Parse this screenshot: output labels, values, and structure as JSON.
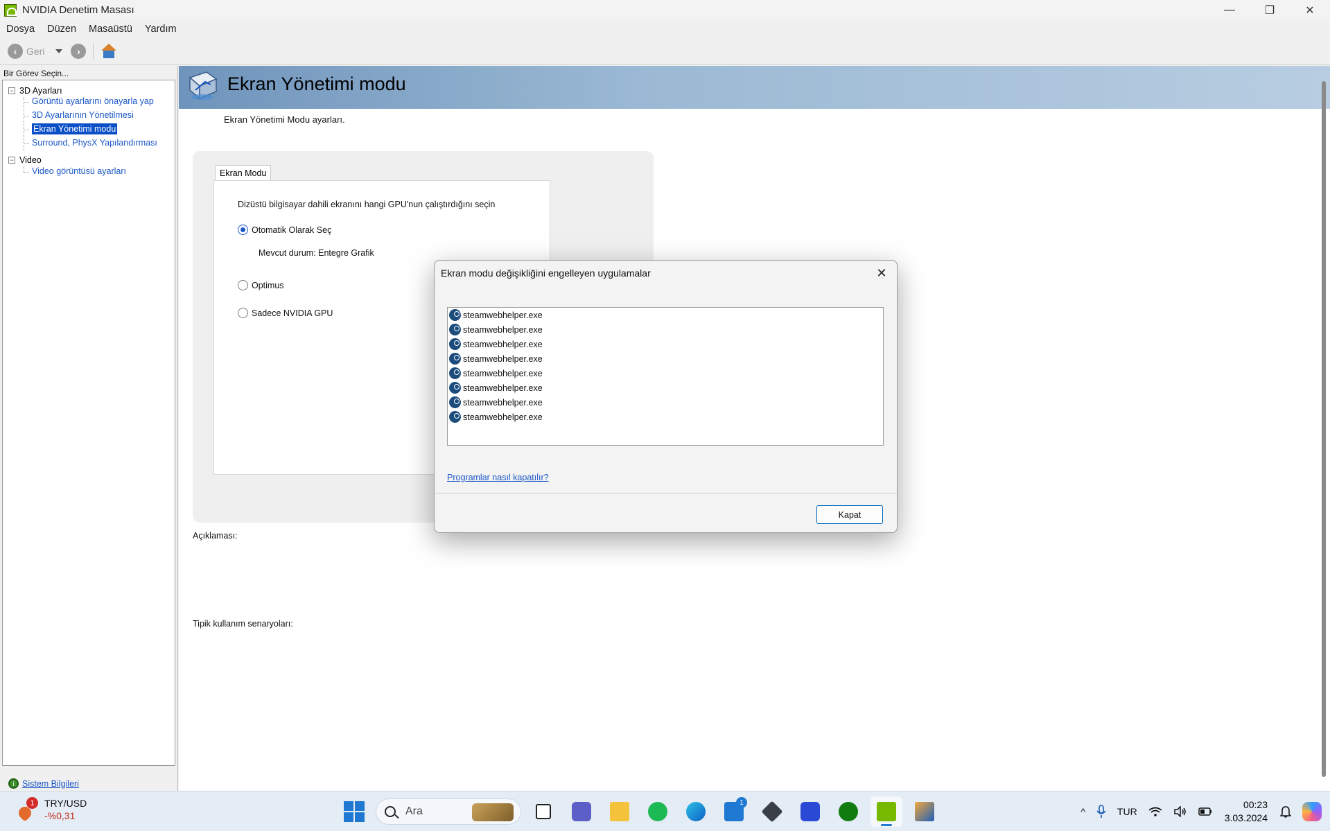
{
  "window": {
    "title": "NVIDIA Denetim Masası",
    "controls": {
      "minimize": "—",
      "restore": "❐",
      "close": "✕"
    }
  },
  "menu": [
    "Dosya",
    "Düzen",
    "Masaüstü",
    "Yardım"
  ],
  "toolbar": {
    "back_label": "Geri"
  },
  "sidebar": {
    "task_label": "Bir Görev Seçin...",
    "groups": [
      {
        "label": "3D Ayarları",
        "items": [
          "Görüntü ayarlarını önayarla yap",
          "3D Ayarlarının Yönetilmesi",
          "Ekran Yönetimi modu",
          "Surround, PhysX Yapılandırması"
        ]
      },
      {
        "label": "Video",
        "items": [
          "Video görüntüsü ayarları"
        ]
      }
    ],
    "selected": "Ekran Yönetimi modu",
    "system_info": "Sistem Bilgileri"
  },
  "main": {
    "title": "Ekran Yönetimi modu",
    "description": "Ekran Yönetimi Modu ayarları.",
    "tab": "Ekran Modu",
    "prompt": "Dizüstü bilgisayar dahili ekranını hangi GPU'nun çalıştırdığını seçin",
    "options": [
      {
        "label": "Otomatik Olarak Seç",
        "checked": true
      },
      {
        "label": "Optimus",
        "checked": false
      },
      {
        "label": "Sadece NVIDIA GPU",
        "checked": false
      }
    ],
    "current_status": "Mevcut durum: Entegre Grafik",
    "description_label": "Açıklaması:",
    "usage_label": "Tipik kullanım senaryoları:"
  },
  "dialog": {
    "title": "Ekran modu değişikliğini engelleyen uygulamalar",
    "items": [
      "steamwebhelper.exe",
      "steamwebhelper.exe",
      "steamwebhelper.exe",
      "steamwebhelper.exe",
      "steamwebhelper.exe",
      "steamwebhelper.exe",
      "steamwebhelper.exe",
      "steamwebhelper.exe"
    ],
    "help_link": "Programlar nasıl kapatılır?",
    "close_button": "Kapat",
    "close_glyph": "✕"
  },
  "taskbar": {
    "widget": {
      "title": "TRY/USD",
      "value": "-%0,31",
      "badge": "1"
    },
    "search_placeholder": "Ara",
    "store_badge": "1",
    "tray": {
      "language": "TUR",
      "time": "00:23",
      "date": "3.03.2024",
      "chevron": "^"
    }
  },
  "colors": {
    "accent": "#0a4fc8",
    "link": "#1a56c6",
    "nvidia_green": "#76b900",
    "banner": "#9bb9d4"
  }
}
